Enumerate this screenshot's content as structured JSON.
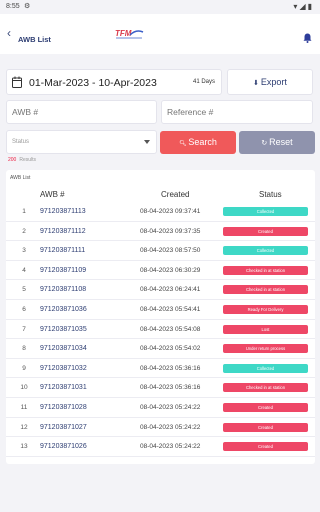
{
  "statusbar": {
    "time": "8:55",
    "gear": "⚙",
    "right": "▾◢▮"
  },
  "header": {
    "back_icon": "‹",
    "title": "AWB List",
    "logo_text": "TFM"
  },
  "filters": {
    "date_range": "01-Mar-2023  -  10-Apr-2023",
    "days": "41 Days",
    "export_label": "Export",
    "awb_placeholder": "AWB #",
    "reference_placeholder": "Reference #",
    "status_placeholder": "Status",
    "search_label": "Search",
    "reset_label": "Reset"
  },
  "results": {
    "count": "200",
    "label": "Results"
  },
  "list": {
    "title": "AWB List",
    "columns": {
      "awb": "AWB #",
      "created": "Created",
      "status": "Status"
    },
    "rows": [
      {
        "num": "1",
        "awb": "971203871113",
        "created": "08-04-2023 09:37:41",
        "status": "Collected",
        "color": "#3ed8c6"
      },
      {
        "num": "2",
        "awb": "971203871112",
        "created": "08-04-2023 09:37:35",
        "status": "Created",
        "color": "#ee4766"
      },
      {
        "num": "3",
        "awb": "971203871111",
        "created": "08-04-2023 08:57:50",
        "status": "Collected",
        "color": "#3ed8c6"
      },
      {
        "num": "4",
        "awb": "971203871109",
        "created": "08-04-2023 06:30:29",
        "status": "Checked in at station",
        "color": "#ee4766"
      },
      {
        "num": "5",
        "awb": "971203871108",
        "created": "08-04-2023 06:24:41",
        "status": "Checked in at station",
        "color": "#ee4766"
      },
      {
        "num": "6",
        "awb": "971203871036",
        "created": "08-04-2023 05:54:41",
        "status": "Ready For Delivery",
        "color": "#ee4766"
      },
      {
        "num": "7",
        "awb": "971203871035",
        "created": "08-04-2023 05:54:08",
        "status": "Lost",
        "color": "#ee4766"
      },
      {
        "num": "8",
        "awb": "971203871034",
        "created": "08-04-2023 05:54:02",
        "status": "Under return process",
        "color": "#ee4766"
      },
      {
        "num": "9",
        "awb": "971203871032",
        "created": "08-04-2023 05:36:16",
        "status": "Collected",
        "color": "#3ed8c6"
      },
      {
        "num": "10",
        "awb": "971203871031",
        "created": "08-04-2023 05:36:16",
        "status": "Checked in at station",
        "color": "#ee4766"
      },
      {
        "num": "11",
        "awb": "971203871028",
        "created": "08-04-2023 05:24:22",
        "status": "Created",
        "color": "#ee4766"
      },
      {
        "num": "12",
        "awb": "971203871027",
        "created": "08-04-2023 05:24:22",
        "status": "Created",
        "color": "#ee4766"
      },
      {
        "num": "13",
        "awb": "971203871026",
        "created": "08-04-2023 05:24:22",
        "status": "Created",
        "color": "#ee4766"
      }
    ]
  }
}
